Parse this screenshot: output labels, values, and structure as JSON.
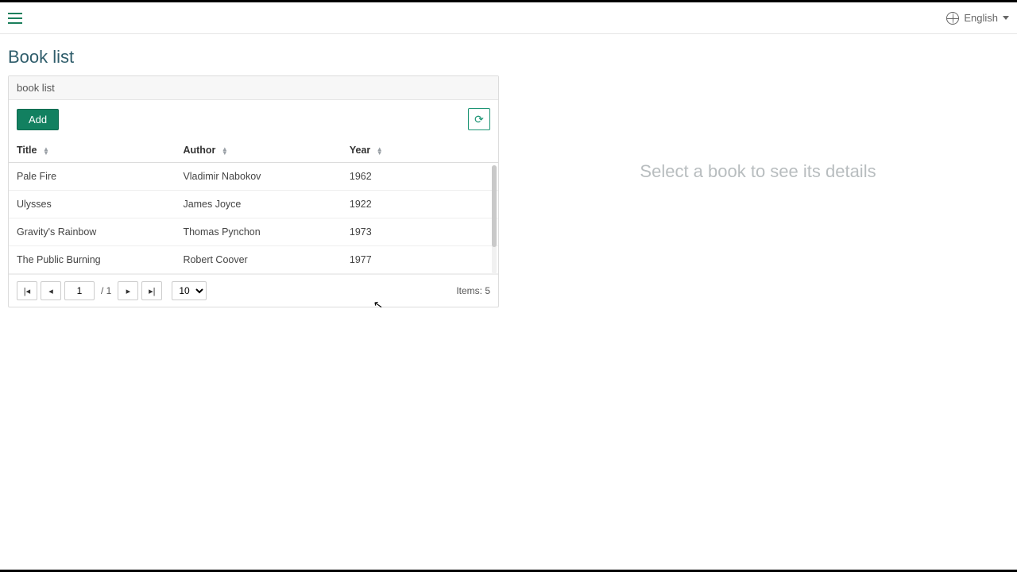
{
  "header": {
    "language_label": "English"
  },
  "page": {
    "title": "Book list"
  },
  "panel": {
    "header": "book list",
    "add_label": "Add"
  },
  "table": {
    "columns": {
      "title": "Title",
      "author": "Author",
      "year": "Year"
    },
    "rows": [
      {
        "title": "Pale Fire",
        "author": "Vladimir Nabokov",
        "year": "1962"
      },
      {
        "title": "Ulysses",
        "author": "James Joyce",
        "year": "1922"
      },
      {
        "title": "Gravity's Rainbow",
        "author": "Thomas Pynchon",
        "year": "1973"
      },
      {
        "title": "The Public Burning",
        "author": "Robert Coover",
        "year": "1977"
      }
    ]
  },
  "pager": {
    "current_page": "1",
    "total_pages_label": "/ 1",
    "page_size": "10",
    "items_label": "Items: 5"
  },
  "details": {
    "placeholder": "Select a book to see its details"
  }
}
